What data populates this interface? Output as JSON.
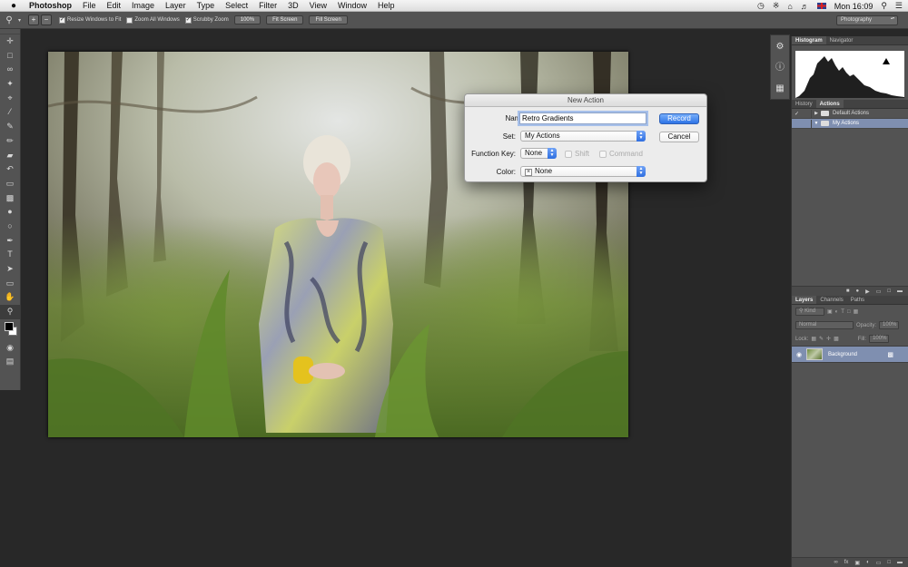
{
  "menubar": {
    "app_name": "Photoshop",
    "items": [
      "File",
      "Edit",
      "Image",
      "Layer",
      "Type",
      "Select",
      "Filter",
      "3D",
      "View",
      "Window",
      "Help"
    ],
    "clock": "Mon 16:09"
  },
  "options_bar": {
    "resize_windows_label": "Resize Windows to Fit",
    "zoom_all_windows_label": "Zoom All Windows",
    "scrubby_zoom_label": "Scrubby Zoom",
    "zoom_percent": "100%",
    "fit_screen_label": "Fit Screen",
    "fill_screen_label": "Fill Screen",
    "workspace": "Photography"
  },
  "dialog": {
    "title": "New Action",
    "name_label": "Name:",
    "name_value": "Retro Gradients",
    "set_label": "Set:",
    "set_value": "My Actions",
    "function_key_label": "Function Key:",
    "function_key_value": "None",
    "shift_label": "Shift",
    "command_label": "Command",
    "color_label": "Color:",
    "color_value": "None",
    "record_label": "Record",
    "cancel_label": "Cancel"
  },
  "panels": {
    "top_tabs": [
      "Histogram",
      "Navigator"
    ],
    "mid_tabs": [
      "History",
      "Actions"
    ],
    "actions": [
      {
        "label": "Default Actions",
        "expanded": false,
        "checked": true
      },
      {
        "label": "My Actions",
        "expanded": true,
        "checked": false
      }
    ],
    "layer_tabs": [
      "Layers",
      "Channels",
      "Paths"
    ],
    "kind_filter": "Kind",
    "blend_mode": "Normal",
    "opacity_label": "Opacity:",
    "opacity_value": "100%",
    "lock_label": "Lock:",
    "fill_label": "Fill:",
    "fill_value": "100%",
    "layers": [
      {
        "name": "Background",
        "locked": true
      }
    ]
  }
}
